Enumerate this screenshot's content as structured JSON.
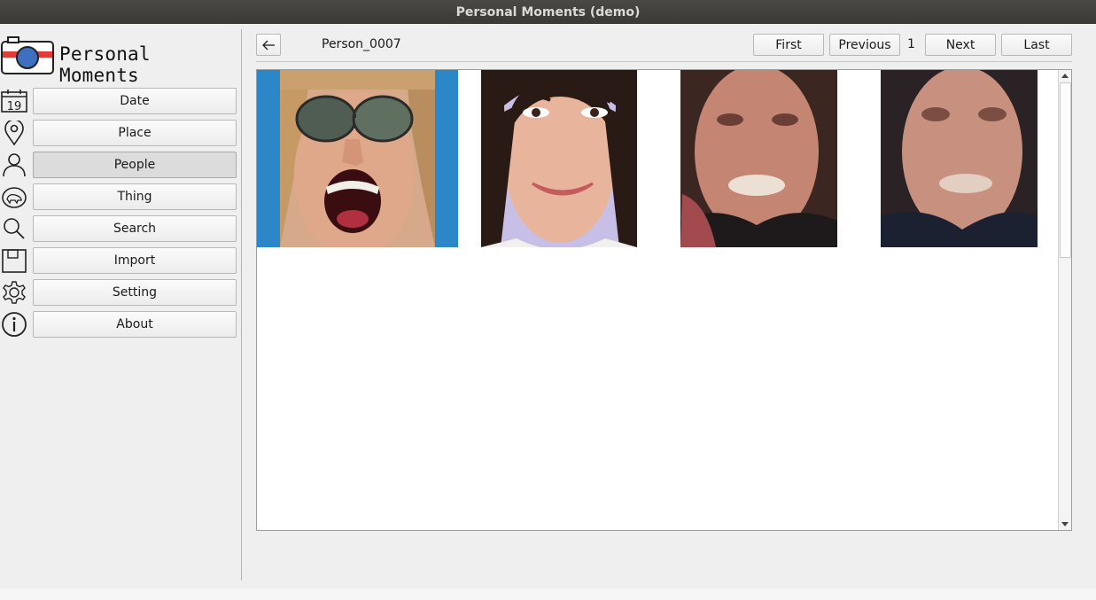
{
  "window": {
    "title": "Personal Moments (demo)"
  },
  "app": {
    "name": "Personal Moments",
    "logo_icon": "camera-icon",
    "calendar_day": "19"
  },
  "nav": {
    "items": [
      {
        "label": "Date",
        "icon": "calendar-icon",
        "active": false
      },
      {
        "label": "Place",
        "icon": "location-pin-icon",
        "active": false
      },
      {
        "label": "People",
        "icon": "person-icon",
        "active": true
      },
      {
        "label": "Thing",
        "icon": "thing-icon",
        "active": false
      },
      {
        "label": "Search",
        "icon": "search-icon",
        "active": false
      },
      {
        "label": "Import",
        "icon": "save-icon",
        "active": false
      },
      {
        "label": "Setting",
        "icon": "gear-icon",
        "active": false
      },
      {
        "label": "About",
        "icon": "info-icon",
        "active": false
      }
    ]
  },
  "toolbar": {
    "back_icon": "arrow-left-icon",
    "person_name": "Person_0007",
    "first_label": "First",
    "previous_label": "Previous",
    "page_number": "1",
    "next_label": "Next",
    "last_label": "Last"
  },
  "gallery": {
    "photos": [
      {
        "subject": "face-photo-sunglasses",
        "selected": true
      },
      {
        "subject": "face-photo-smiling",
        "selected": false
      },
      {
        "subject": "face-photo-smiling-blurry",
        "selected": false
      },
      {
        "subject": "face-photo-smiling-very-blurry",
        "selected": false
      }
    ]
  },
  "colors": {
    "selection": "#2b87c8",
    "logo_red": "#e03c3c",
    "logo_blue": "#3f6fbf"
  }
}
